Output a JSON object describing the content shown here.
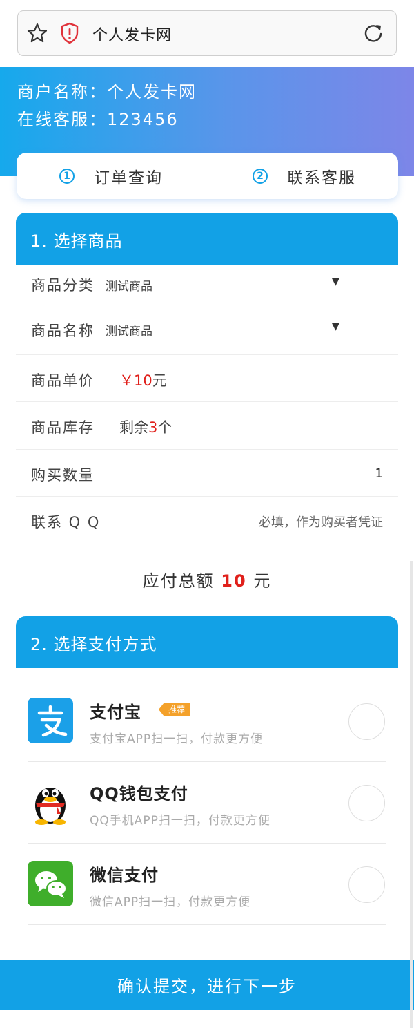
{
  "browser": {
    "url_title": "个人发卡网",
    "icons": [
      "star-icon",
      "shield-warning-icon",
      "reload-icon"
    ]
  },
  "header": {
    "merchant_line": "商户名称：个人发卡网",
    "service_line": "在线客服：123456"
  },
  "nav": {
    "items": [
      {
        "num": "1",
        "label": "订单查询"
      },
      {
        "num": "2",
        "label": "联系客服"
      }
    ]
  },
  "section1": {
    "title": "1. 选择商品",
    "category_label": "商品分类",
    "category_value": "测试商品",
    "name_label": "商品名称",
    "name_value": "测试商品",
    "price_label": "商品单价",
    "price_currency": "￥",
    "price_value": "10",
    "price_unit": "元",
    "stock_label": "商品库存",
    "stock_prefix": "剩余",
    "stock_value": "3",
    "stock_unit": "个",
    "qty_label": "购买数量",
    "qty_value": "1",
    "qq_label": "联系 Q Q",
    "qq_placeholder": "必填，作为购买者凭证"
  },
  "total": {
    "label": "应付总额",
    "amount": "10",
    "unit": "元"
  },
  "section2": {
    "title": "2. 选择支付方式",
    "methods": [
      {
        "name": "支付宝",
        "badge": "推荐",
        "desc": "支付宝APP扫一扫，付款更方便",
        "icon": "alipay-icon"
      },
      {
        "name": "QQ钱包支付",
        "desc": "QQ手机APP扫一扫，付款更方便",
        "icon": "qq-penguin-icon"
      },
      {
        "name": "微信支付",
        "desc": "微信APP扫一扫，付款更方便",
        "icon": "wechat-icon"
      }
    ]
  },
  "submit": {
    "label": "确认提交，进行下一步"
  },
  "colors": {
    "primary": "#12a1e6",
    "price_red": "#e0201b",
    "badge_orange": "#f4a12a",
    "alipay_blue": "#1ba0e8",
    "wechat_green": "#3fae2b"
  }
}
